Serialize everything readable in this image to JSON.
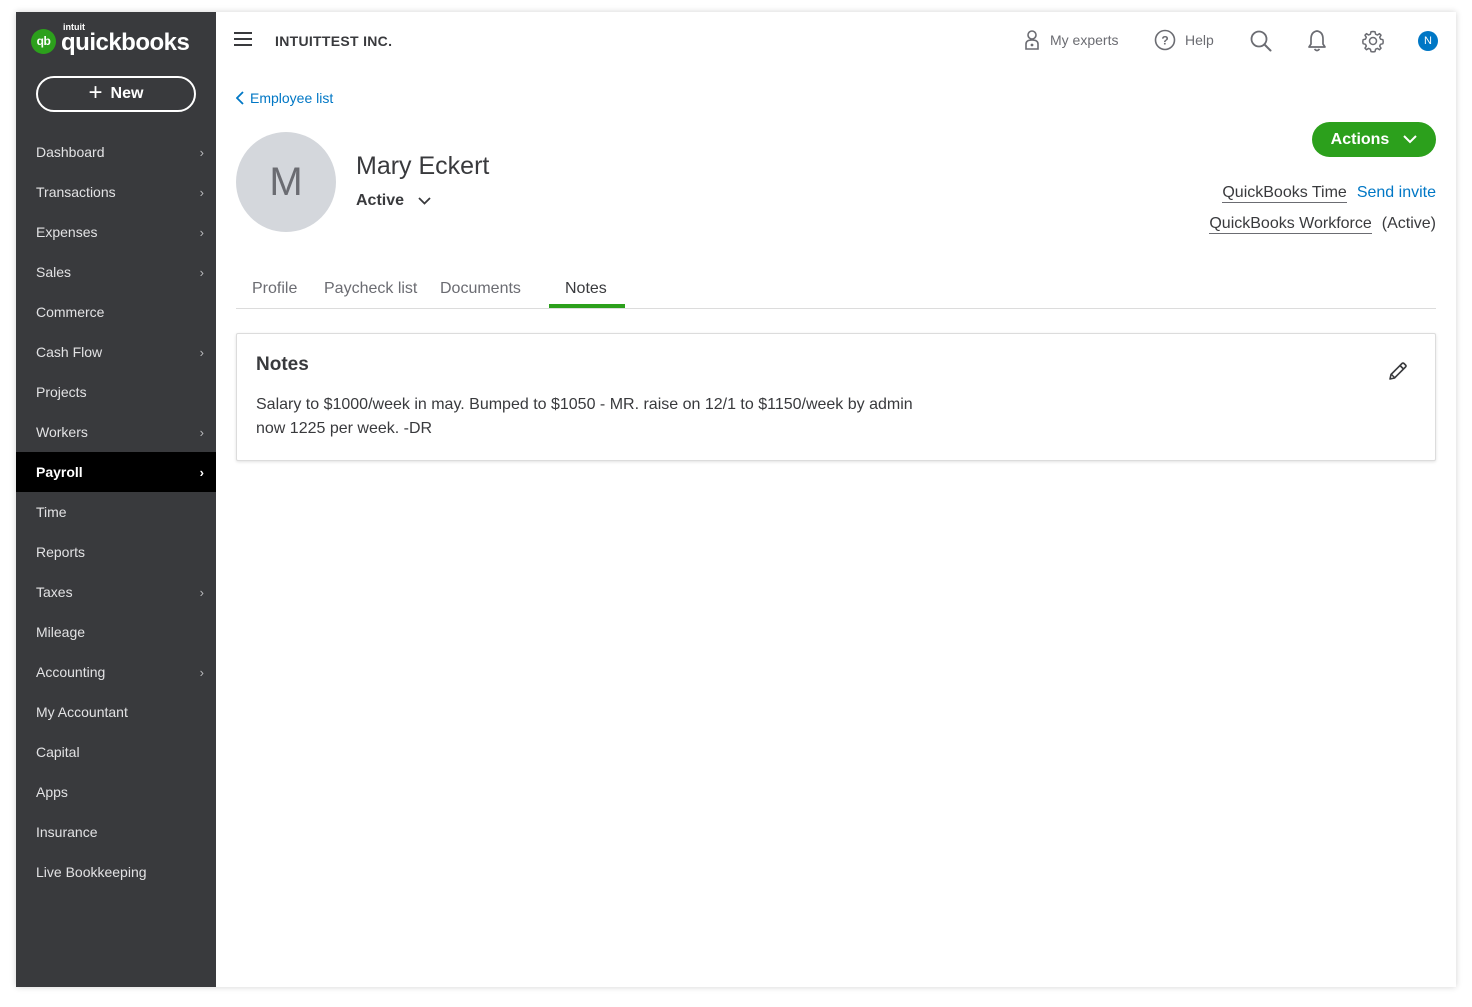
{
  "brand": {
    "badge": "qb",
    "company_small": "intuit",
    "product": "quickbooks",
    "accent": "#2ca01c"
  },
  "sidebar": {
    "new_label": "New",
    "items": [
      {
        "label": "Dashboard",
        "chevron": true
      },
      {
        "label": "Transactions",
        "chevron": true
      },
      {
        "label": "Expenses",
        "chevron": true
      },
      {
        "label": "Sales",
        "chevron": true
      },
      {
        "label": "Commerce",
        "chevron": false
      },
      {
        "label": "Cash Flow",
        "chevron": true
      },
      {
        "label": "Projects",
        "chevron": false
      },
      {
        "label": "Workers",
        "chevron": true
      },
      {
        "label": "Payroll",
        "chevron": true,
        "active": true
      },
      {
        "label": "Time",
        "chevron": false
      },
      {
        "label": "Reports",
        "chevron": false
      },
      {
        "label": "Taxes",
        "chevron": true
      },
      {
        "label": "Mileage",
        "chevron": false
      },
      {
        "label": "Accounting",
        "chevron": true
      },
      {
        "label": "My Accountant",
        "chevron": false
      },
      {
        "label": "Capital",
        "chevron": false
      },
      {
        "label": "Apps",
        "chevron": false
      },
      {
        "label": "Insurance",
        "chevron": false
      },
      {
        "label": "Live Bookkeeping",
        "chevron": false
      }
    ]
  },
  "header": {
    "company_name": "INTUITTEST INC.",
    "my_experts": "My experts",
    "help": "Help",
    "user_initial": "N"
  },
  "employee": {
    "back_link": "Employee list",
    "initial": "M",
    "name": "Mary Eckert",
    "status": "Active",
    "actions_label": "Actions",
    "qb_time": "QuickBooks Time",
    "send_invite": "Send invite",
    "qb_workforce": "QuickBooks Workforce",
    "workforce_status": "(Active)"
  },
  "tabs": [
    {
      "label": "Profile"
    },
    {
      "label": "Paycheck list"
    },
    {
      "label": "Documents"
    },
    {
      "label": "Notes",
      "active": true
    }
  ],
  "notes": {
    "title": "Notes",
    "line1": "Salary to $1000/week in may. Bumped to $1050 - MR. raise on 12/1 to $1150/week by admin",
    "line2": "now 1225 per week. -DR"
  }
}
